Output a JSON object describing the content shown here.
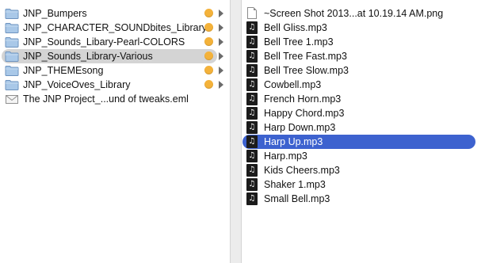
{
  "left_column": {
    "items": [
      {
        "label": "JNP_Bumpers",
        "icon": "folder-icon",
        "kind": "folder"
      },
      {
        "label": "JNP_CHARACTER_SOUNDbites_Library",
        "icon": "folder-icon",
        "kind": "folder"
      },
      {
        "label": "JNP_Sounds_Libary-Pearl-COLORS",
        "icon": "folder-icon",
        "kind": "folder"
      },
      {
        "label": "JNP_Sounds_Library-Various",
        "icon": "folder-icon",
        "kind": "folder",
        "selected": true
      },
      {
        "label": "JNP_THEMEsong",
        "icon": "folder-icon",
        "kind": "folder"
      },
      {
        "label": "JNP_VoiceOves_Library",
        "icon": "folder-icon",
        "kind": "folder"
      },
      {
        "label": "The JNP Project_...und of tweaks.eml",
        "icon": "envelope-icon",
        "kind": "email"
      }
    ],
    "tag_color": "#f4b23a"
  },
  "right_column": {
    "items": [
      {
        "label": "~Screen Shot 2013...at 10.19.14 AM.png",
        "icon": "document-icon"
      },
      {
        "label": "Bell Gliss.mp3",
        "icon": "audio-file-icon"
      },
      {
        "label": "Bell Tree 1.mp3",
        "icon": "audio-file-icon"
      },
      {
        "label": "Bell Tree Fast.mp3",
        "icon": "audio-file-icon"
      },
      {
        "label": "Bell Tree Slow.mp3",
        "icon": "audio-file-icon"
      },
      {
        "label": "Cowbell.mp3",
        "icon": "audio-file-icon"
      },
      {
        "label": "French Horn.mp3",
        "icon": "audio-file-icon"
      },
      {
        "label": "Happy Chord.mp3",
        "icon": "audio-file-icon"
      },
      {
        "label": "Harp Down.mp3",
        "icon": "audio-file-icon"
      },
      {
        "label": "Harp Up.mp3",
        "icon": "audio-file-icon",
        "selected": true
      },
      {
        "label": "Harp.mp3",
        "icon": "audio-file-icon"
      },
      {
        "label": "Kids Cheers.mp3",
        "icon": "audio-file-icon"
      },
      {
        "label": "Shaker 1.mp3",
        "icon": "audio-file-icon"
      },
      {
        "label": "Small Bell.mp3",
        "icon": "audio-file-icon"
      }
    ],
    "selection_color": "#3d62cf"
  }
}
